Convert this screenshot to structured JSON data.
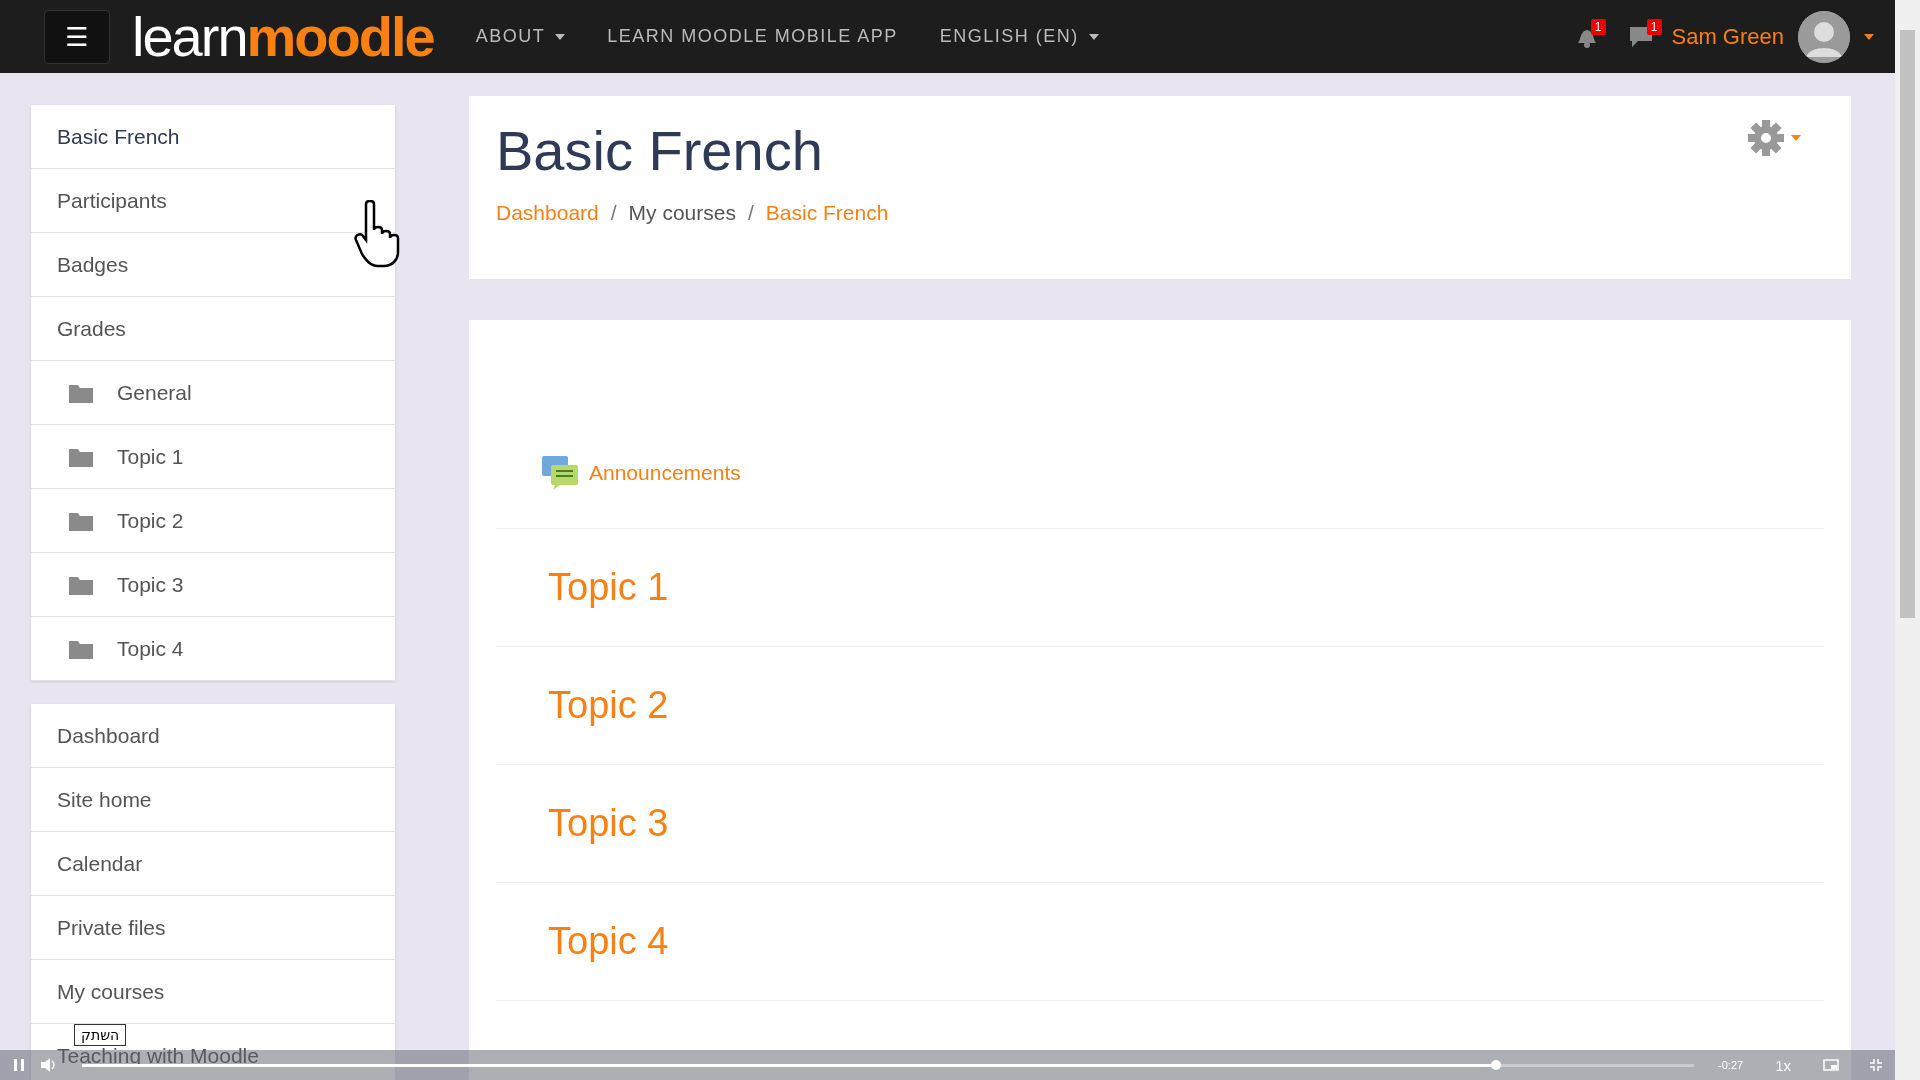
{
  "topbar": {
    "menu_button": "☰",
    "logo_light": "learn",
    "logo_bold": "moodle",
    "nav": [
      {
        "label": "ABOUT",
        "dropdown": true
      },
      {
        "label": "LEARN MOODLE MOBILE APP",
        "dropdown": false
      },
      {
        "label": "ENGLISH (EN)",
        "dropdown": true
      }
    ],
    "notifications_count": "1",
    "messages_count": "1",
    "user_name": "Sam Green"
  },
  "course_nav": [
    {
      "label": "Basic French",
      "kind": "heading"
    },
    {
      "label": "Participants",
      "kind": "link"
    },
    {
      "label": "Badges",
      "kind": "link"
    },
    {
      "label": "Grades",
      "kind": "link"
    },
    {
      "label": "General",
      "kind": "folder"
    },
    {
      "label": "Topic 1",
      "kind": "folder"
    },
    {
      "label": "Topic 2",
      "kind": "folder"
    },
    {
      "label": "Topic 3",
      "kind": "folder"
    },
    {
      "label": "Topic 4",
      "kind": "folder"
    }
  ],
  "site_nav": [
    {
      "label": "Dashboard",
      "kind": "link"
    },
    {
      "label": "Site home",
      "kind": "link"
    },
    {
      "label": "Calendar",
      "kind": "link"
    },
    {
      "label": "Private files",
      "kind": "link"
    },
    {
      "label": "My courses",
      "kind": "link"
    },
    {
      "label": "Teaching with Moodle",
      "kind": "link"
    }
  ],
  "page_header": {
    "title": "Basic French",
    "separator": "/",
    "breadcrumb": [
      {
        "label": "Dashboard",
        "link": true
      },
      {
        "label": "My courses",
        "link": false
      },
      {
        "label": "Basic French",
        "link": true
      }
    ]
  },
  "content": {
    "announcements": "Announcements",
    "topics": [
      "Topic 1",
      "Topic 2",
      "Topic 3",
      "Topic 4"
    ]
  },
  "player": {
    "playing": true,
    "tooltip": "השתק",
    "level": 0.877,
    "time": "-0:27",
    "speed": "1x"
  }
}
